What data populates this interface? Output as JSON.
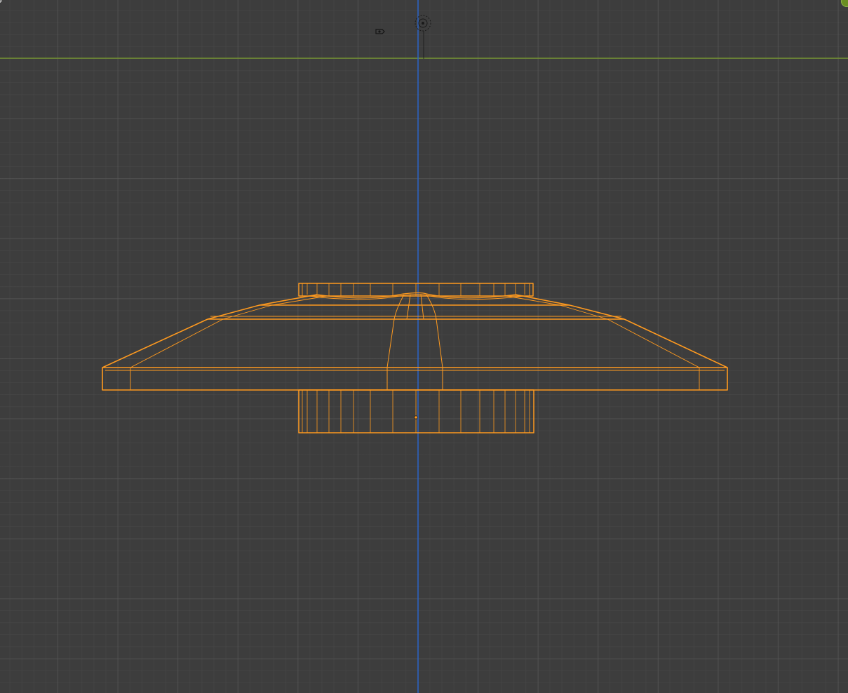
{
  "viewport": {
    "view": "front-orthographic",
    "shading": "wireframe",
    "colors": {
      "background": "#3d3d3d",
      "grid_major": "#5a5a5a",
      "grid_minor": "#4b4b4b",
      "x_axis": "#7a9f2a",
      "z_axis": "#2a64c8",
      "selection": "#ff9a1f",
      "selection_edge": "#e88a18"
    },
    "icons": {
      "camera": "camera-icon",
      "light": "light-icon",
      "origin": "origin-dot-icon",
      "gizmo": "navigation-gizmo-icon"
    },
    "selected_object": {
      "mode": "object",
      "selected": true
    }
  }
}
